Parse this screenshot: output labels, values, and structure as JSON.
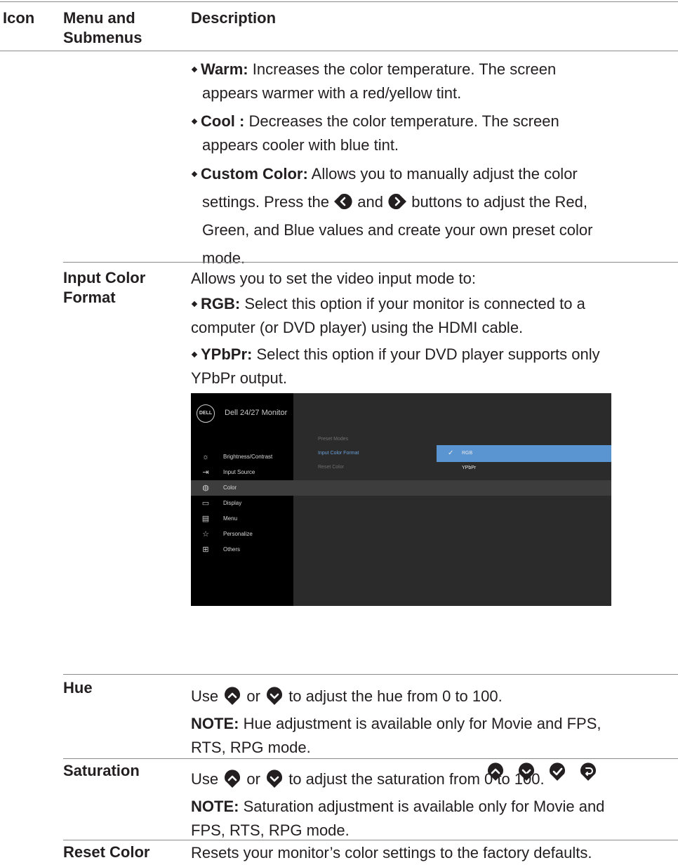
{
  "header": {
    "icon": "Icon",
    "menu_line1": "Menu and",
    "menu_line2": "Submenus",
    "description": "Description"
  },
  "color_presets": [
    {
      "term": "Warm:",
      "line1": "Increases the color temperature. The screen",
      "line2": "appears warmer with a red/yellow tint."
    },
    {
      "term": "Cool :",
      "line1": "Decreases the color temperature. The screen",
      "line2": "appears cooler with blue tint."
    },
    {
      "term": "Custom Color:",
      "line1": "Allows you to manually adjust the color",
      "line2_a": "settings. Press the",
      "line2_b": "and",
      "line2_c": "buttons to adjust the Red,",
      "line3": "Green, and Blue values and create your own preset color",
      "line4": "mode."
    }
  ],
  "input_color_format": {
    "menu_line1": "Input Color",
    "menu_line2": "Format",
    "intro": "Allows you to set the video input mode to:",
    "rgb_term": "RGB:",
    "rgb_line1": "Select this option if your monitor is connected to a",
    "rgb_line2": "computer (or DVD player) using the HDMI cable.",
    "ypbpr_term": "YPbPr:",
    "ypbpr_line1": "Select this option if your DVD player supports only",
    "ypbpr_line2": "YPbPr output."
  },
  "osd": {
    "logo": "DELL",
    "title": "Dell 24/27 Monitor",
    "menu": [
      {
        "label": "Brightness/Contrast",
        "icon": "brightness-icon",
        "glyph": "☼"
      },
      {
        "label": "Input Source",
        "icon": "input-source-icon",
        "glyph": "⇥"
      },
      {
        "label": "Color",
        "icon": "color-palette-icon",
        "glyph": "◍"
      },
      {
        "label": "Display",
        "icon": "display-icon",
        "glyph": "▭"
      },
      {
        "label": "Menu",
        "icon": "menu-icon",
        "glyph": "▤"
      },
      {
        "label": "Personalize",
        "icon": "star-icon",
        "glyph": "☆"
      },
      {
        "label": "Others",
        "icon": "others-icon",
        "glyph": "⊞"
      }
    ],
    "submenu": [
      "Preset Modes",
      "Input Color Format",
      "Reset Color"
    ],
    "options": [
      {
        "label": "RGB",
        "check": "✓"
      },
      {
        "label": "YPbPr"
      }
    ],
    "selected_color": "#5b95d1"
  },
  "hue": {
    "menu": "Hue",
    "use": "Use",
    "or": "or",
    "rest": "to adjust the hue from 0 to 100.",
    "note_label": "NOTE:",
    "note_line1": "Hue adjustment is available only for Movie and FPS,",
    "note_line2": "RTS, RPG mode."
  },
  "saturation": {
    "menu": "Saturation",
    "use": "Use",
    "or": "or",
    "rest": "to adjust the saturation from 0 to 100.",
    "note_label": "NOTE:",
    "note_line1": "Saturation adjustment is available only for Movie and",
    "note_line2": "FPS, RTS, RPG mode."
  },
  "reset_color": {
    "menu": "Reset Color",
    "description": "Resets your monitor’s color settings to the factory defaults."
  },
  "nav_buttons": [
    "up-button-icon",
    "down-button-icon",
    "ok-button-icon",
    "back-button-icon"
  ]
}
